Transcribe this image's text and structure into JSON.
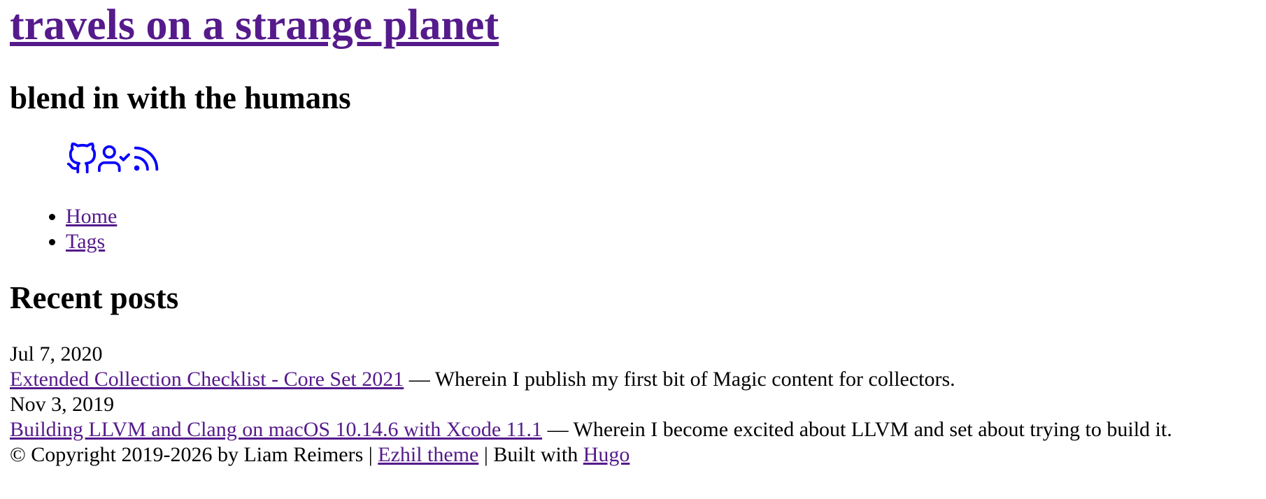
{
  "header": {
    "title": "travels on a strange planet",
    "subtitle": "blend in with the humans"
  },
  "social": [
    {
      "icon": "github-icon"
    },
    {
      "icon": "user-check-icon"
    },
    {
      "icon": "rss-icon"
    }
  ],
  "nav": {
    "items": [
      {
        "label": "Home"
      },
      {
        "label": "Tags"
      }
    ]
  },
  "recent": {
    "heading": "Recent posts",
    "posts": [
      {
        "date": "Jul 7, 2020",
        "title": "Extended Collection Checklist - Core Set 2021",
        "separator": " — ",
        "summary": "Wherein I publish my first bit of Magic content for collectors."
      },
      {
        "date": "Nov 3, 2019",
        "title": "Building LLVM and Clang on macOS 10.14.6 with Xcode 11.1",
        "separator": " — ",
        "summary": "Wherein I become excited about LLVM and set about trying to build it."
      }
    ]
  },
  "footer": {
    "copyright": "© Copyright 2019-2026 by Liam Reimers | ",
    "theme_link": "Ezhil theme",
    "built_with": " | Built with ",
    "hugo_link": "Hugo"
  },
  "colors": {
    "link": "#551a8b",
    "icon": "#0a00ff",
    "text": "#000000"
  }
}
